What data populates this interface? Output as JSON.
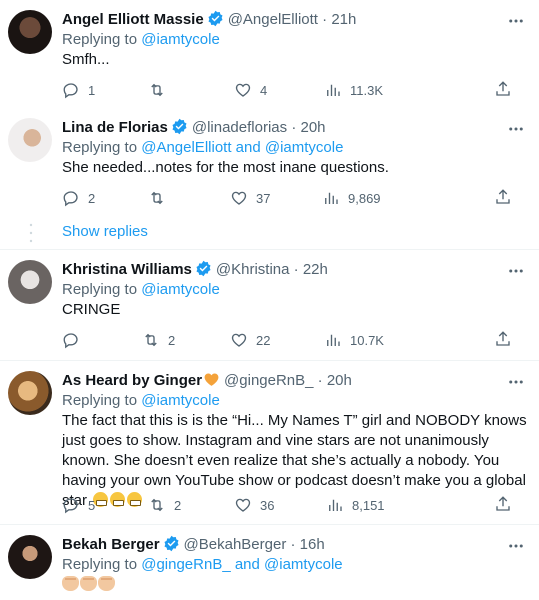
{
  "tweets": [
    {
      "name": "Angel Elliott Massie",
      "handle": "@AngelElliott",
      "time": "21h",
      "replying_prefix": "Replying to",
      "replying_to": "@iamtycole",
      "text": "Smfh...",
      "replies": "1",
      "retweets": "",
      "likes": "4",
      "views": "11.3K"
    },
    {
      "name": "Lina de Florias",
      "handle": "@linadeflorias",
      "time": "20h",
      "replying_prefix": "Replying to",
      "replying_to": "@AngelElliott and @iamtycole",
      "text": "She needed...notes for the most inane questions.",
      "replies": "2",
      "retweets": "",
      "likes": "37",
      "views": "9,869"
    },
    {
      "name": "Khristina Williams",
      "handle": "@Khristina",
      "time": "22h",
      "replying_prefix": "Replying to",
      "replying_to": "@iamtycole",
      "text": "CRINGE",
      "replies": "",
      "retweets": "2",
      "likes": "22",
      "views": "10.7K"
    },
    {
      "name": "As Heard by Ginger",
      "handle": "@gingeRnB_",
      "time": "20h",
      "replying_prefix": "Replying to",
      "replying_to": "@iamtycole",
      "text": "The fact that this is is the “Hi... My Names T” girl and NOBODY knows just goes to show. Instagram and vine stars are not unanimously known. She doesn’t even realize that she’s actually a nobody. You having your own YouTube show or podcast doesn’t make you a global star",
      "replies": "5",
      "retweets": "2",
      "likes": "36",
      "views": "8,151"
    },
    {
      "name": "Bekah Berger",
      "handle": "@BekahBerger",
      "time": "16h",
      "replying_prefix": "Replying to",
      "replying_to": "@gingeRnB_ and @iamtycole",
      "text": ""
    }
  ],
  "show_replies": "Show replies",
  "separator": "·",
  "colors": {
    "link": "#1d9bf0",
    "secondary": "#536471",
    "verified": "#1d9bf0",
    "ginger_badge": "#f4a23a"
  },
  "icons": [
    "verified-badge-icon",
    "more-icon",
    "reply-icon",
    "retweet-icon",
    "like-icon",
    "views-icon",
    "share-icon",
    "grimace-emoji-icon",
    "clap-emoji-icon",
    "heart-badge-icon"
  ]
}
